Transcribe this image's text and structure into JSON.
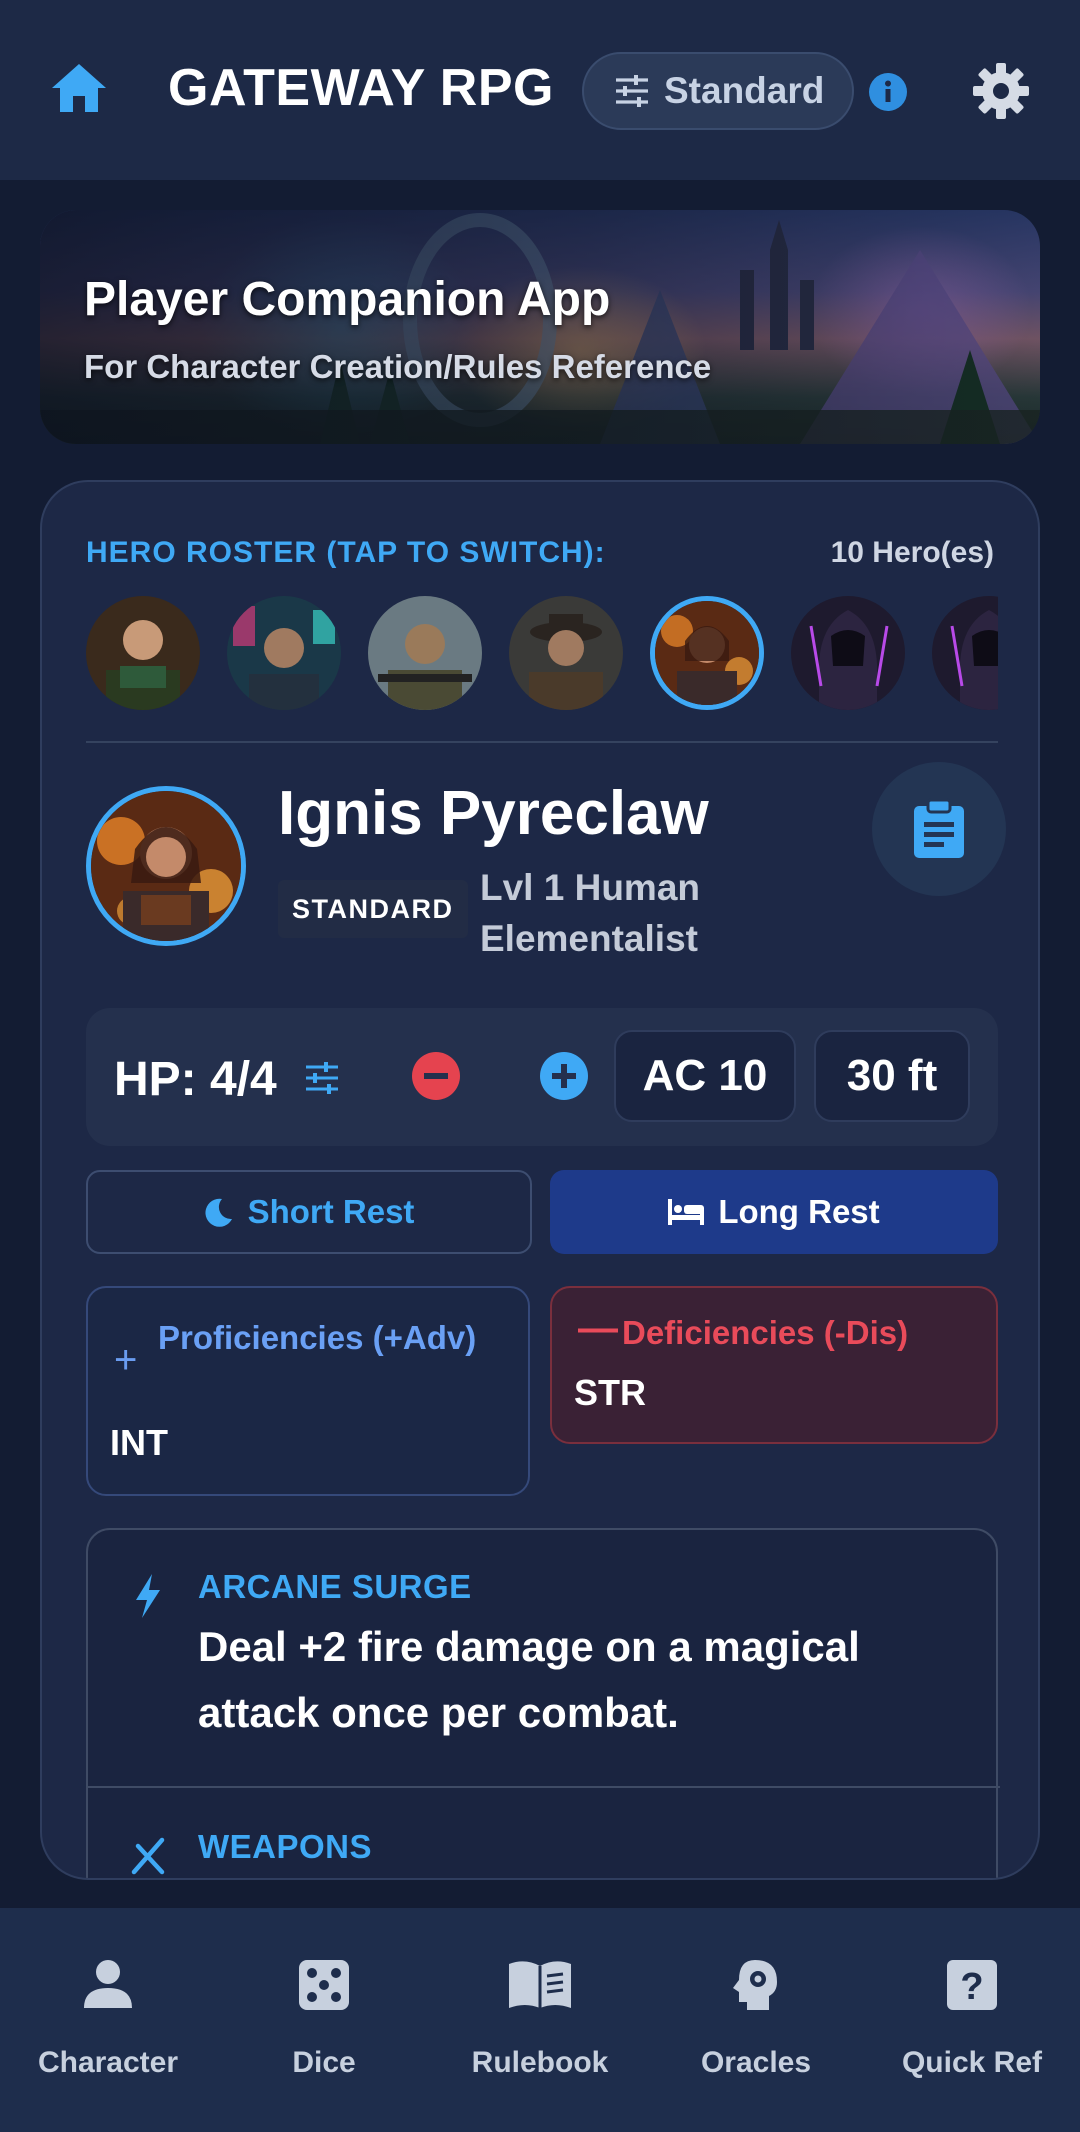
{
  "app": {
    "title": "GATEWAY RPG",
    "mode": "Standard"
  },
  "banner": {
    "title": "Player Companion App",
    "subtitle": "For Character Creation/Rules Reference"
  },
  "roster": {
    "label": "HERO ROSTER (TAP TO SWITCH):",
    "count": "10 Hero(es)",
    "selected_index": 4
  },
  "hero": {
    "name": "Ignis Pyreclaw",
    "badge": "STANDARD",
    "class_line": "Lvl 1 Human Elementalist",
    "hp": "HP: 4/4",
    "ac": "AC 10",
    "speed": "30 ft"
  },
  "rest": {
    "short_label": "Short Rest",
    "long_label": "Long Rest"
  },
  "proficiencies": {
    "title": "Proficiencies (+Adv)",
    "value": "INT"
  },
  "deficiencies": {
    "title": "Deficiencies (-Dis)",
    "value": "STR"
  },
  "traits": [
    {
      "title": "ARCANE SURGE",
      "description": "Deal +2 fire damage on a magical attack once per combat.",
      "icon": "bolt-icon"
    },
    {
      "title": "WEAPONS",
      "description": "",
      "icon": "crossed-swords-icon"
    }
  ],
  "nav": [
    {
      "label": "Character",
      "icon": "person-icon"
    },
    {
      "label": "Dice",
      "icon": "dice-icon"
    },
    {
      "label": "Rulebook",
      "icon": "book-icon"
    },
    {
      "label": "Oracles",
      "icon": "oracle-head-icon"
    },
    {
      "label": "Quick Ref",
      "icon": "help-icon"
    }
  ],
  "colors": {
    "accent": "#3fa9f5",
    "long_rest": "#1e3a8a",
    "deficiency": "#e94b5a",
    "background": "#131c33"
  }
}
